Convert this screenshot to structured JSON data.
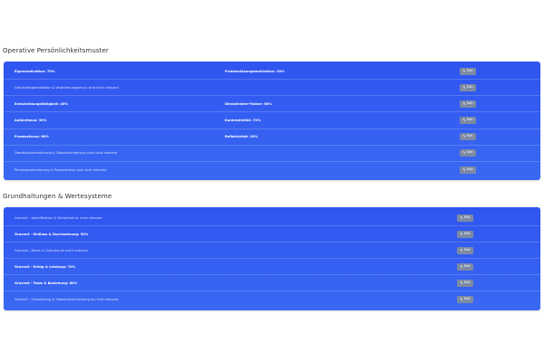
{
  "section1": {
    "title": "Operative Persönlichkeitsmuster",
    "edit_label": "Edit",
    "rows": [
      {
        "left": "Eigenmotivation: 70%",
        "right": "Problemlösungsmotivation: 30%",
        "bold": true
      },
      {
        "left": "Gleichzeitigkeitsfaktor & Veränderungsdruck sind nicht relevant",
        "right": "",
        "bold": false
      },
      {
        "left": "Entscheidungsfähigkeit: 40%",
        "right": "Dienstleister-Faktor: 60%",
        "bold": true
      },
      {
        "left": "Außenfokus: 30%",
        "right": "Kontrastivität: 70%",
        "bold": true
      },
      {
        "left": "Prozessfocus: 60%",
        "right": "Reflektivität: 20%",
        "bold": true
      },
      {
        "left": "Überblicksorientierung & Detailorientierung sind nicht relevant",
        "right": "",
        "bold": false
      },
      {
        "left": "Personenorientierung & Prozessfokus sind nicht relevant",
        "right": "",
        "bold": false
      }
    ]
  },
  "section2": {
    "title": "Grundhaltungen & Wertesysteme",
    "edit_label": "Edit",
    "rows": [
      {
        "left": "Graves2 - Identifikation & Sicherheit ist nicht relevant",
        "bold": false
      },
      {
        "left": "Graves3 - Einfluss & Durchsetzung: 50%",
        "bold": true
      },
      {
        "left": "Graves4 - Recht & Ordnung ist nicht relevant",
        "bold": false
      },
      {
        "left": "Graves5 - Erfolg & Leistung: 70%",
        "bold": true
      },
      {
        "left": "Graves6 - Team & Beziehung: 60%",
        "bold": true
      },
      {
        "left": "Graves7 - Entwicklung & Selbstverwirklichung ist nicht relevant",
        "bold": false
      }
    ]
  }
}
